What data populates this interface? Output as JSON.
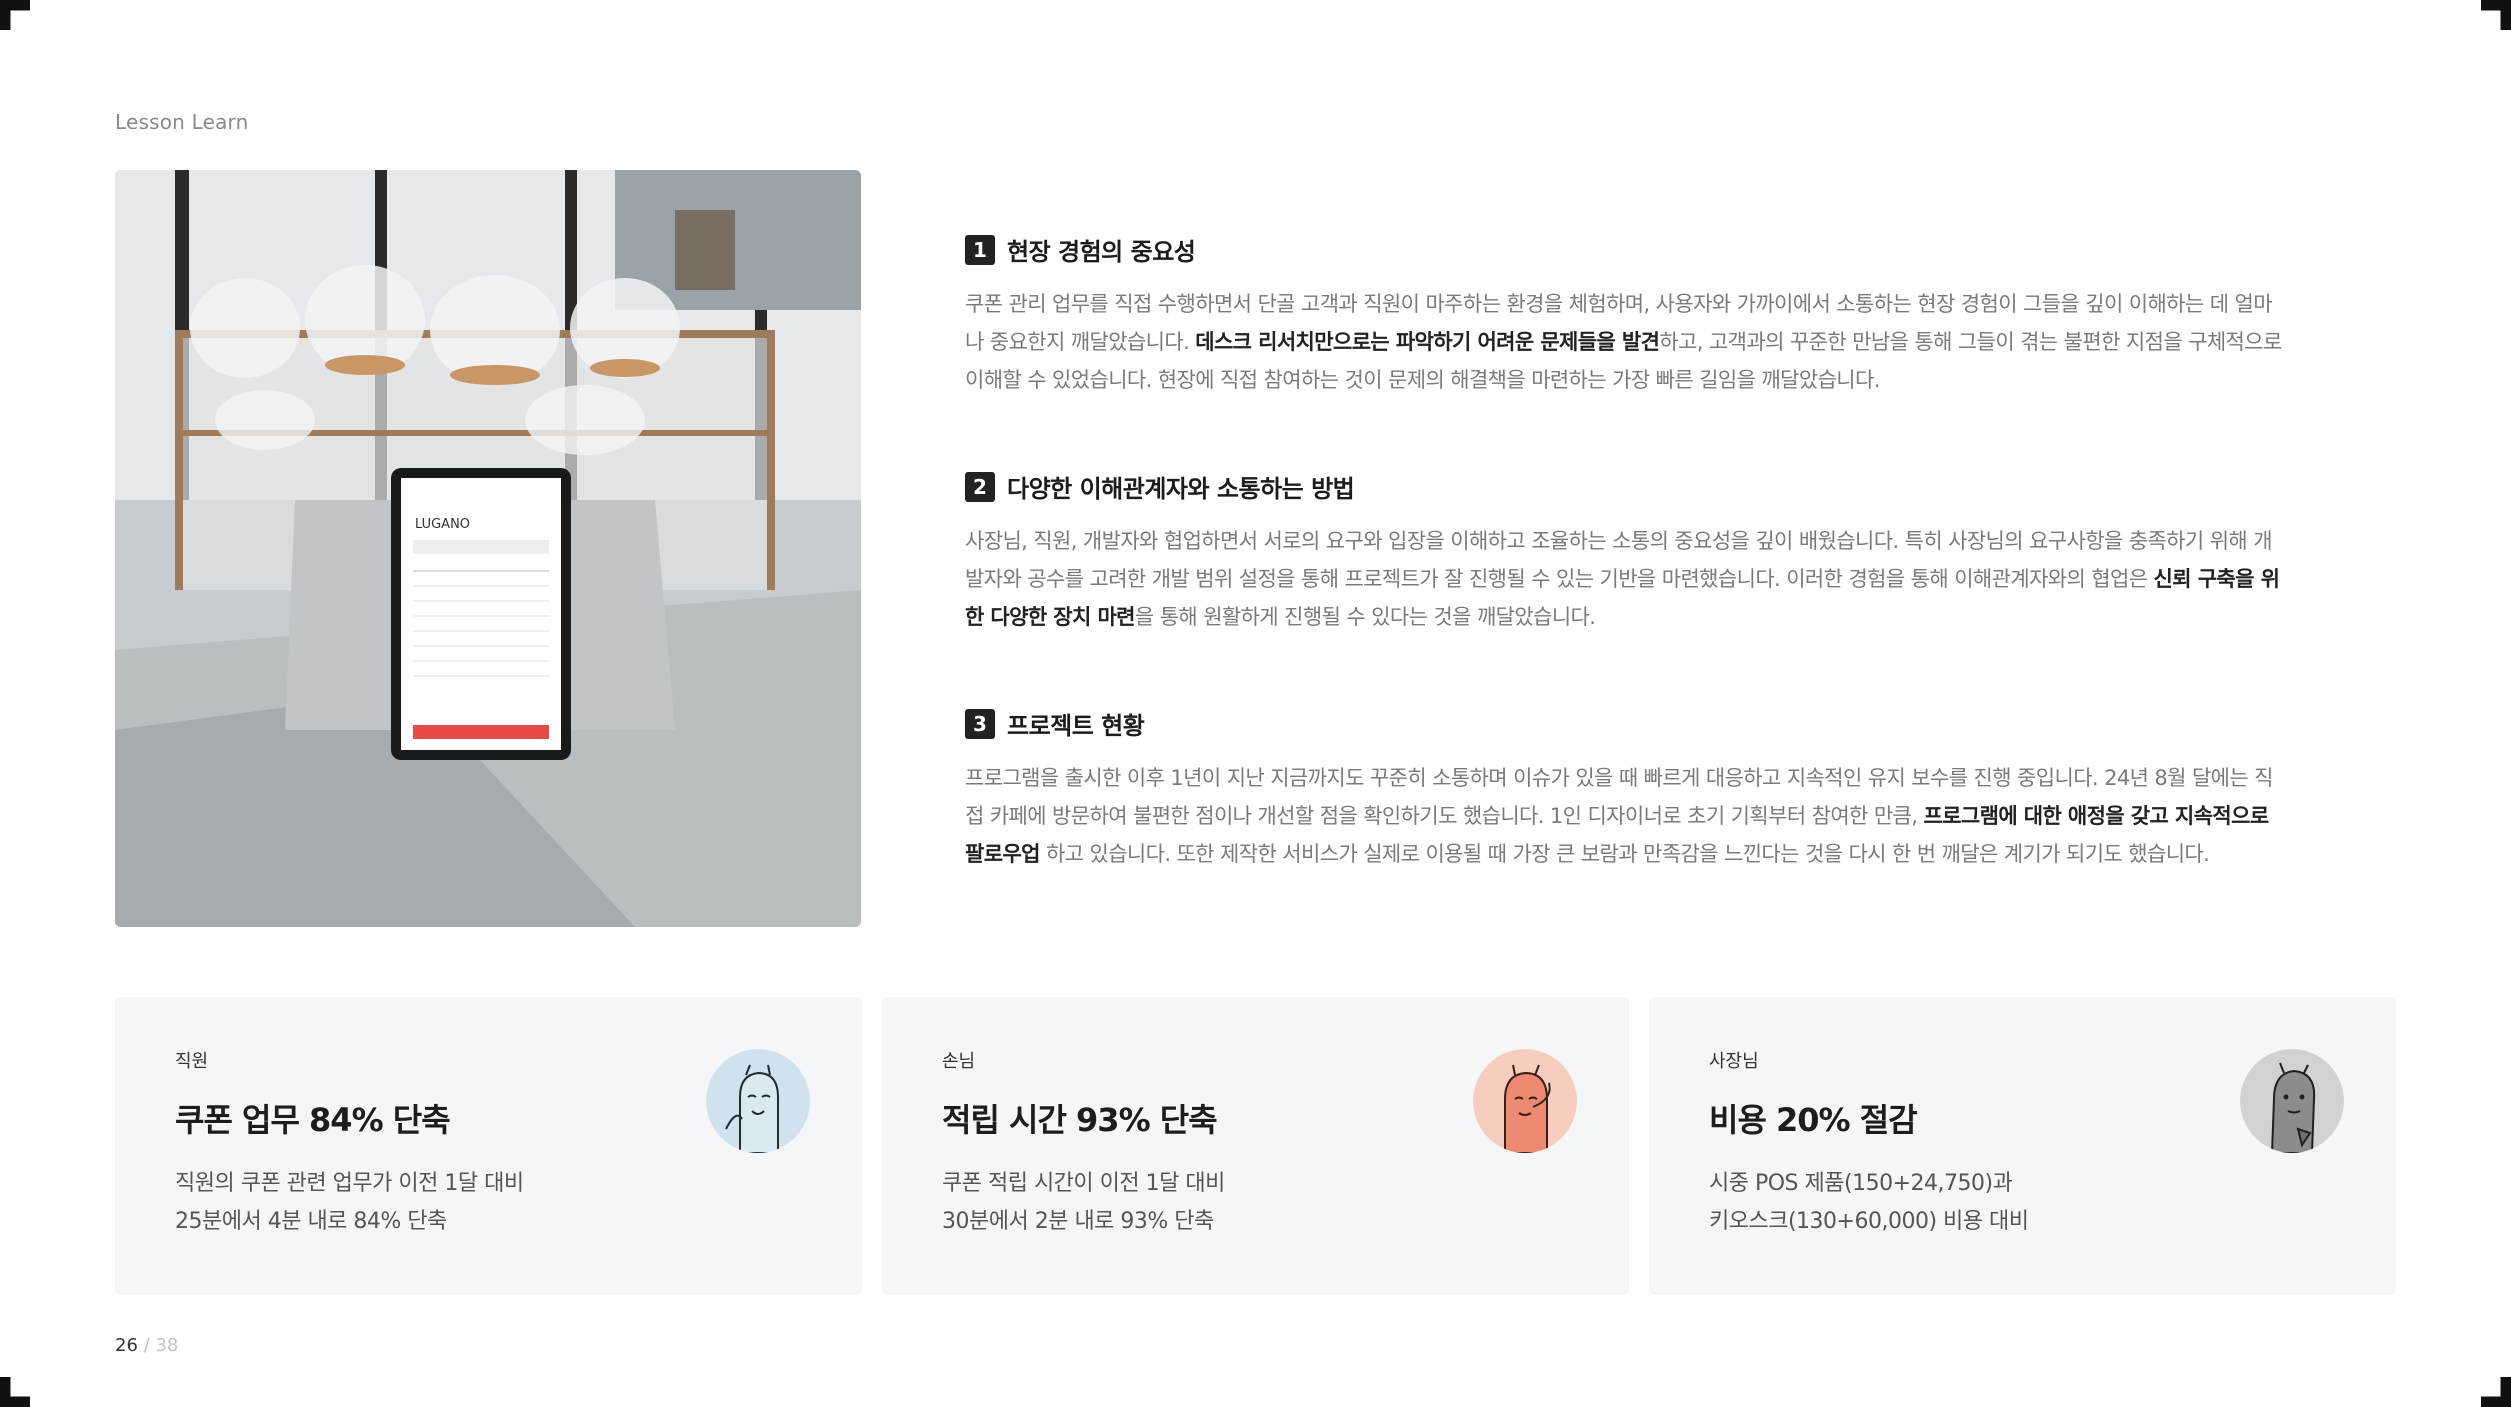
{
  "section_label": "Lesson Learn",
  "photo": {
    "tablet_brand": "LUGANO"
  },
  "points": [
    {
      "number": "1",
      "title": "현장 경험의 중요성",
      "body_pre": "쿠폰 관리 업무를 직접 수행하면서 단골 고객과 직원이 마주하는 환경을 체험하며, 사용자와 가까이에서 소통하는 현장 경험이 그들을 깊이 이해하는 데 얼마나 중요한지 깨달았습니다. ",
      "body_bold": "데스크 리서치만으로는 파악하기 어려운 문제들을 발견",
      "body_post": "하고, 고객과의 꾸준한 만남을 통해 그들이 겪는 불편한 지점을 구체적으로 이해할 수 있었습니다. 현장에 직접 참여하는 것이 문제의 해결책을 마련하는 가장 빠른 길임을 깨달았습니다."
    },
    {
      "number": "2",
      "title": "다양한 이해관계자와 소통하는 방법",
      "body_pre": "사장님, 직원, 개발자와 협업하면서 서로의 요구와 입장을 이해하고 조율하는 소통의 중요성을 깊이 배웠습니다. 특히 사장님의 요구사항을 충족하기 위해 개발자와 공수를 고려한 개발 범위 설정을 통해 프로젝트가 잘 진행될 수 있는 기반을 마련했습니다. 이러한 경험을 통해 이해관계자와의 협업은 ",
      "body_bold": "신뢰 구축을 위한 다양한 장치 마련",
      "body_post": "을 통해 원활하게 진행될 수 있다는 것을 깨달았습니다."
    },
    {
      "number": "3",
      "title": "프로젝트 현황",
      "body_pre": "프로그램을 출시한 이후 1년이 지난 지금까지도 꾸준히 소통하며 이슈가 있을 때 빠르게 대응하고 지속적인 유지 보수를 진행 중입니다. 24년 8월 달에는 직접 카페에 방문하여 불편한 점이나 개선할 점을 확인하기도 했습니다. 1인 디자이너로 초기 기획부터 참여한 만큼, ",
      "body_bold": "프로그램에 대한 애정을 갖고 지속적으로 팔로우업",
      "body_post": " 하고 있습니다. 또한 제작한 서비스가 실제로 이용될 때 가장 큰 보람과 만족감을 느낀다는 것을 다시 한 번 깨달은 계기가 되기도 했습니다."
    }
  ],
  "cards": [
    {
      "role": "직원",
      "headline": "쿠폰 업무 84% 단축",
      "desc_line1": "직원의 쿠폰 관련 업무가 이전 1달 대비",
      "desc_line2": "25분에서 4분 내로 84% 단축",
      "avatar_color": "#cfe2ee",
      "avatar_icon": "employee-character-icon"
    },
    {
      "role": "손님",
      "headline": "적립 시간 93% 단축",
      "desc_line1": "쿠폰 적립 시간이 이전 1달 대비",
      "desc_line2": "30분에서 2분 내로 93% 단축",
      "avatar_color": "#f6cdbf",
      "avatar_icon": "customer-character-icon"
    },
    {
      "role": "사장님",
      "headline": "비용 20% 절감",
      "desc_line1": "시중 POS 제품(150+24,750)과",
      "desc_line2": "키오스크(130+60,000) 비용 대비",
      "avatar_color": "#d2d2d2",
      "avatar_icon": "owner-character-icon"
    }
  ],
  "pager": {
    "current": "26",
    "separator": "/",
    "total": "38"
  }
}
